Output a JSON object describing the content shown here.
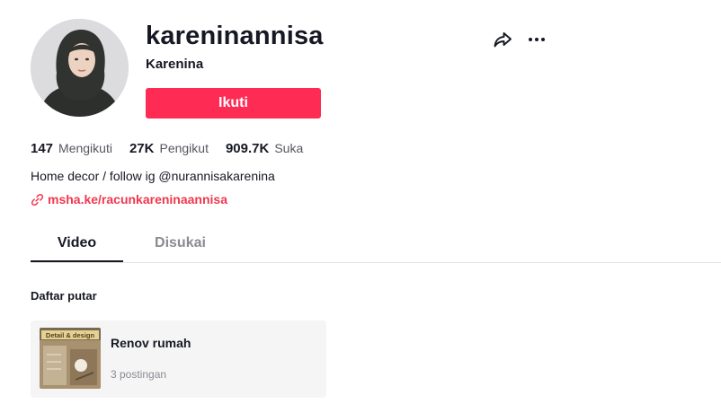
{
  "profile": {
    "username": "kareninannisa",
    "nickname": "Karenina",
    "follow_label": "Ikuti",
    "bio": "Home decor / follow ig @nurannisakarenina",
    "link": "msha.ke/racunkareninaannisa"
  },
  "stats": [
    {
      "value": "147",
      "label": "Mengikuti"
    },
    {
      "value": "27K",
      "label": "Pengikut"
    },
    {
      "value": "909.7K",
      "label": "Suka"
    }
  ],
  "icons": {
    "share": "share-icon",
    "more": "more-icon",
    "link": "link-icon"
  },
  "tabs": [
    {
      "label": "Video",
      "active": true
    },
    {
      "label": "Disukai",
      "active": false
    }
  ],
  "playlist": {
    "heading": "Daftar putar",
    "items": [
      {
        "title": "Renov rumah",
        "count": "3 postingan",
        "thumb_caption": "Detail & design"
      }
    ]
  },
  "colors": {
    "accent": "#fe2c55",
    "link": "#f0374f",
    "text": "#161823",
    "muted": "#8a8b91"
  }
}
